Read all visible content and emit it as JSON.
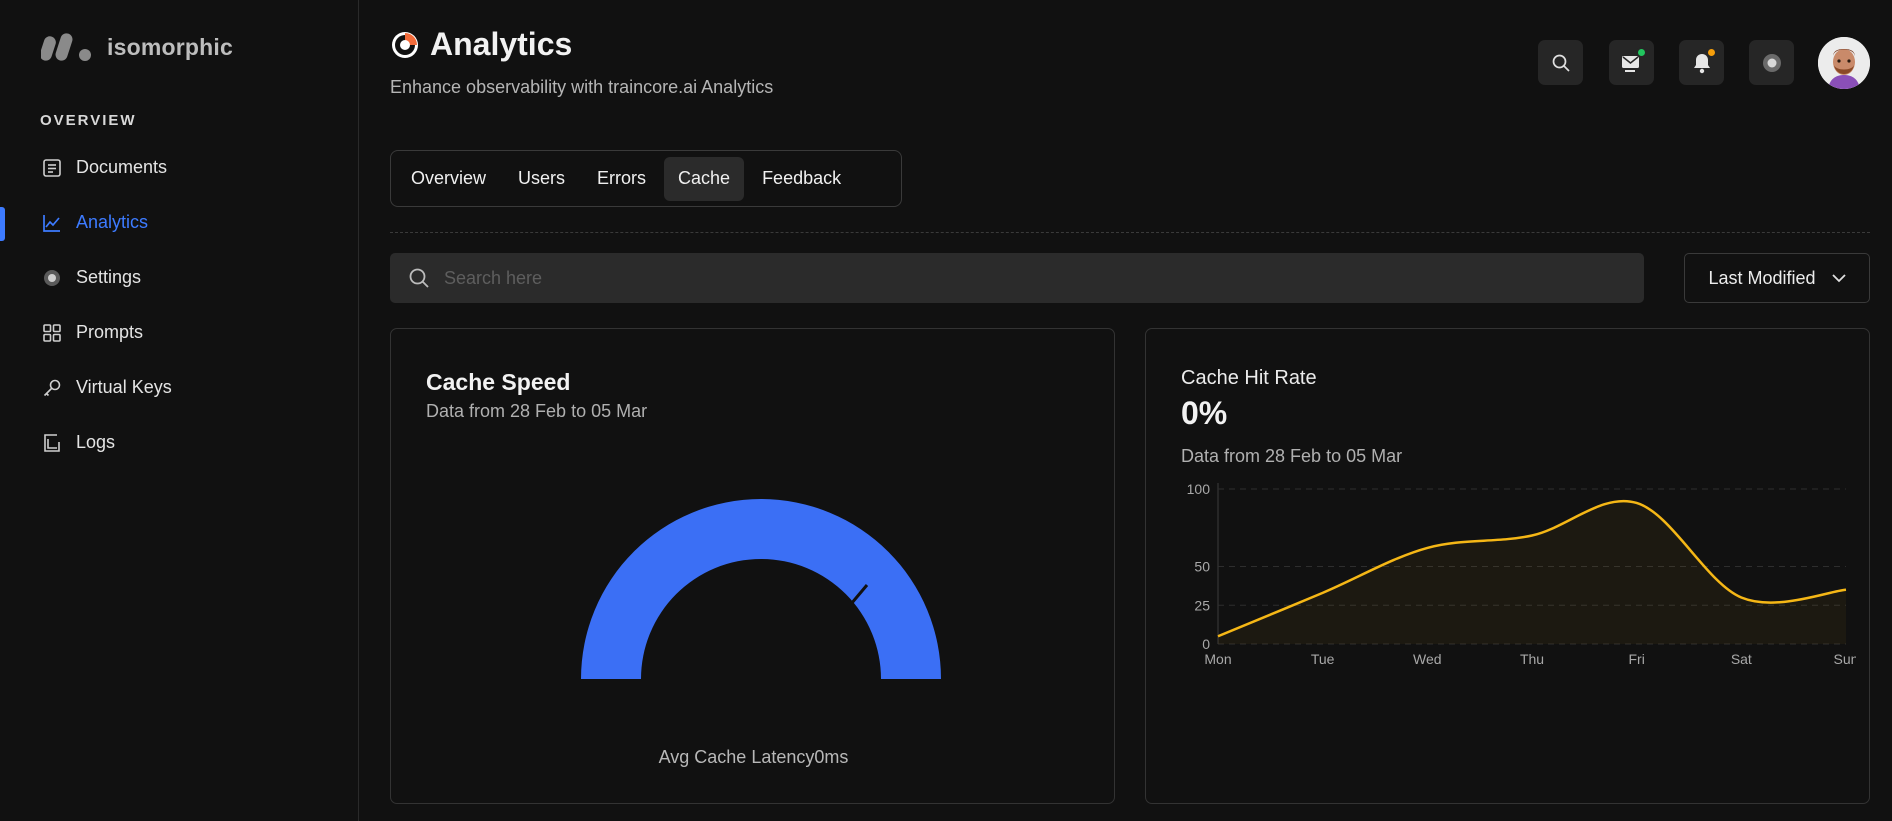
{
  "brand": {
    "name": "isomorphic"
  },
  "sidebar": {
    "section_label": "OVERVIEW",
    "items": [
      {
        "label": "Documents",
        "icon": "document-icon",
        "active": false
      },
      {
        "label": "Analytics",
        "icon": "chart-line-icon",
        "active": true
      },
      {
        "label": "Settings",
        "icon": "gear-icon",
        "active": false
      },
      {
        "label": "Prompts",
        "icon": "grid-icon",
        "active": false
      },
      {
        "label": "Virtual Keys",
        "icon": "key-icon",
        "active": false
      },
      {
        "label": "Logs",
        "icon": "logs-icon",
        "active": false
      }
    ]
  },
  "header": {
    "title": "Analytics",
    "subtitle": "Enhance observability with traincore.ai Analytics"
  },
  "tabs": [
    {
      "label": "Overview",
      "active": false
    },
    {
      "label": "Users",
      "active": false
    },
    {
      "label": "Errors",
      "active": false
    },
    {
      "label": "Cache",
      "active": true
    },
    {
      "label": "Feedback",
      "active": false
    }
  ],
  "search": {
    "placeholder": "Search here"
  },
  "sort": {
    "label": "Last Modified"
  },
  "cache_speed": {
    "title": "Cache Speed",
    "subtitle": "Data from 28 Feb to 05 Mar",
    "gauge_label": "Avg Cache Latency",
    "gauge_value": "0ms",
    "color": "#3b6ff5"
  },
  "cache_hit_rate": {
    "title": "Cache Hit Rate",
    "value": "0%",
    "subtitle": "Data from 28 Feb to 05 Mar"
  },
  "colors": {
    "accent": "#3d7bff",
    "line": "#f5b716",
    "green_dot": "#22c55e",
    "orange_dot": "#f59e0b"
  },
  "chart_data": {
    "type": "line",
    "categories": [
      "Mon",
      "Tue",
      "Wed",
      "Thu",
      "Fri",
      "Sat",
      "Sun"
    ],
    "values": [
      5,
      33,
      62,
      70,
      91,
      30,
      35
    ],
    "yticks": [
      0,
      25,
      50,
      100
    ],
    "ylim": [
      0,
      100
    ],
    "grid": true,
    "title": "",
    "xlabel": "",
    "ylabel": ""
  }
}
